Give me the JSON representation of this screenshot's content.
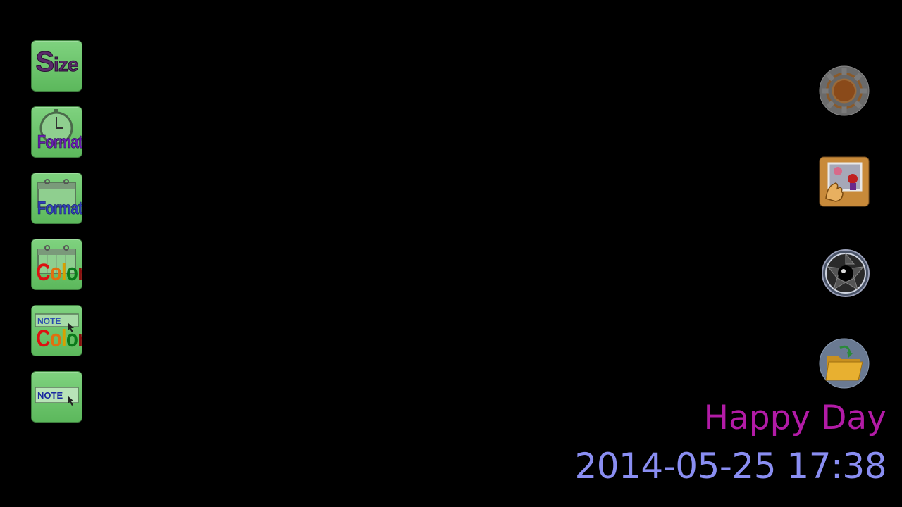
{
  "left_tools": [
    {
      "name": "size-button",
      "label_main": "S",
      "label_rest": "ize",
      "icon": "size-icon"
    },
    {
      "name": "time-format-button",
      "label": "Format",
      "icon": "clock-format-icon"
    },
    {
      "name": "date-format-button",
      "label": "Format",
      "icon": "calendar-format-icon"
    },
    {
      "name": "date-color-button",
      "label_letters": [
        "C",
        "o",
        "l",
        "o",
        "r"
      ],
      "icon": "calendar-color-icon"
    },
    {
      "name": "note-color-button",
      "label_letters": [
        "C",
        "o",
        "l",
        "o",
        "r"
      ],
      "note_label": "NOTE",
      "icon": "note-color-icon"
    },
    {
      "name": "note-button",
      "note_label": "NOTE",
      "icon": "note-icon"
    }
  ],
  "right_tools": [
    {
      "name": "settings-button",
      "icon": "gear-icon"
    },
    {
      "name": "background-image-button",
      "icon": "picture-touch-icon"
    },
    {
      "name": "camera-button",
      "icon": "camera-shutter-icon"
    },
    {
      "name": "folder-button",
      "icon": "folder-icon"
    }
  ],
  "overlay": {
    "note_text": "Happy Day",
    "datetime_text": "2014-05-25 17:38",
    "note_color": "#b21ba6",
    "datetime_color": "#8a8ef2"
  },
  "colors": {
    "background": "#000000",
    "tool_green": "#6cc46c"
  }
}
